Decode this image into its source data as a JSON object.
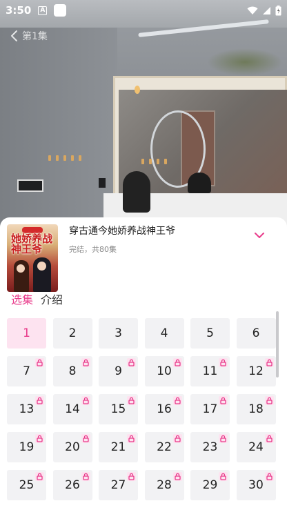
{
  "status_bar": {
    "time": "3:50",
    "app_icon_letter": "A"
  },
  "player": {
    "back_label": "第1集"
  },
  "drama": {
    "title": "穿古通今她娇养战神王爷",
    "meta": "完结，共80集",
    "cover_text": "她娇养战神王爷",
    "cover_badge": "穿古通今"
  },
  "tabs": [
    {
      "label": "选集",
      "active": true
    },
    {
      "label": "介绍",
      "active": false
    }
  ],
  "episodes": [
    {
      "n": "1",
      "locked": false,
      "current": true
    },
    {
      "n": "2",
      "locked": false,
      "current": false
    },
    {
      "n": "3",
      "locked": false,
      "current": false
    },
    {
      "n": "4",
      "locked": false,
      "current": false
    },
    {
      "n": "5",
      "locked": false,
      "current": false
    },
    {
      "n": "6",
      "locked": false,
      "current": false
    },
    {
      "n": "7",
      "locked": true,
      "current": false
    },
    {
      "n": "8",
      "locked": true,
      "current": false
    },
    {
      "n": "9",
      "locked": true,
      "current": false
    },
    {
      "n": "10",
      "locked": true,
      "current": false
    },
    {
      "n": "11",
      "locked": true,
      "current": false
    },
    {
      "n": "12",
      "locked": true,
      "current": false
    },
    {
      "n": "13",
      "locked": true,
      "current": false
    },
    {
      "n": "14",
      "locked": true,
      "current": false
    },
    {
      "n": "15",
      "locked": true,
      "current": false
    },
    {
      "n": "16",
      "locked": true,
      "current": false
    },
    {
      "n": "17",
      "locked": true,
      "current": false
    },
    {
      "n": "18",
      "locked": true,
      "current": false
    },
    {
      "n": "19",
      "locked": true,
      "current": false
    },
    {
      "n": "20",
      "locked": true,
      "current": false
    },
    {
      "n": "21",
      "locked": true,
      "current": false
    },
    {
      "n": "22",
      "locked": true,
      "current": false
    },
    {
      "n": "23",
      "locked": true,
      "current": false
    },
    {
      "n": "24",
      "locked": true,
      "current": false
    },
    {
      "n": "25",
      "locked": true,
      "current": false
    },
    {
      "n": "26",
      "locked": true,
      "current": false
    },
    {
      "n": "27",
      "locked": true,
      "current": false
    },
    {
      "n": "28",
      "locked": true,
      "current": false
    },
    {
      "n": "29",
      "locked": true,
      "current": false
    },
    {
      "n": "30",
      "locked": true,
      "current": false
    }
  ],
  "colors": {
    "accent": "#e83a8a",
    "current_bg": "#fde3f0",
    "cell_bg": "#f2f2f4"
  },
  "icons": {
    "back": "chevron-left-icon",
    "collapse": "chevron-down-icon",
    "lock": "lock-icon",
    "wifi": "wifi-icon",
    "signal": "signal-icon",
    "battery": "battery-icon"
  }
}
